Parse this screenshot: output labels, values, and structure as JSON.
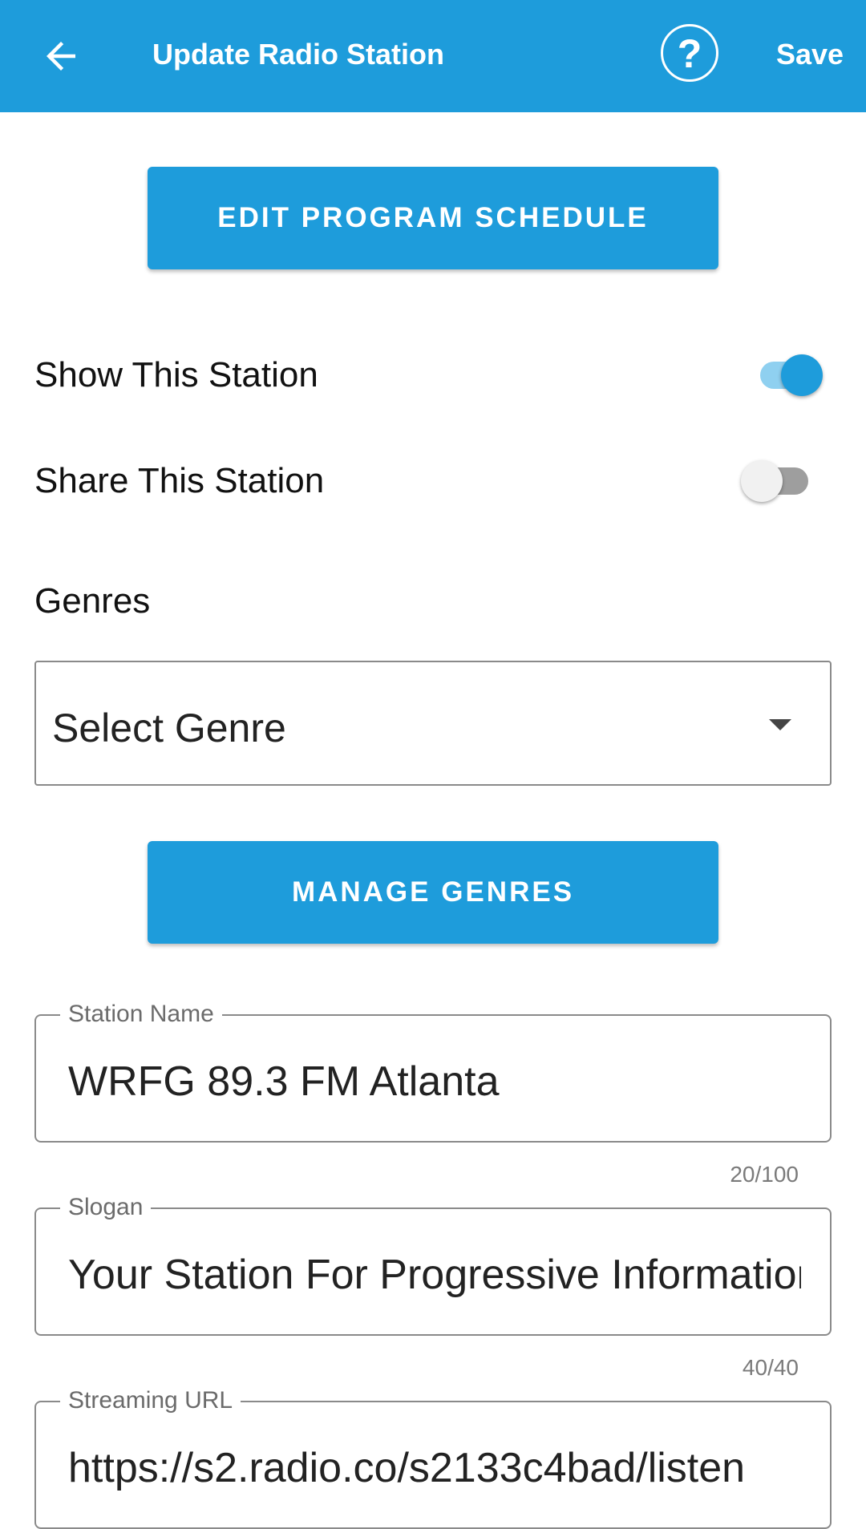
{
  "app_bar": {
    "title": "Update Radio Station",
    "help_symbol": "?",
    "save_label": "Save",
    "back_icon": "arrow-left-icon",
    "help_icon": "help-circle-icon"
  },
  "buttons": {
    "edit_schedule": "EDIT PROGRAM SCHEDULE",
    "manage_genres": "MANAGE GENRES"
  },
  "toggles": {
    "show_station": {
      "label": "Show This Station",
      "on": true
    },
    "share_station": {
      "label": "Share This Station",
      "on": false
    }
  },
  "genres": {
    "label": "Genres",
    "select_placeholder": "Select Genre",
    "arrow_icon": "dropdown-arrow-icon"
  },
  "fields": {
    "station_name": {
      "label": "Station Name",
      "value": "WRFG 89.3 FM Atlanta",
      "counter": "20/100"
    },
    "slogan": {
      "label": "Slogan",
      "value": "Your Station For Progressive Information",
      "counter": "40/40"
    },
    "streaming_url": {
      "label": "Streaming URL",
      "value": "https://s2.radio.co/s2133c4bad/listen"
    }
  },
  "colors": {
    "primary": "#1e9cdb",
    "switch_track_on": "#8fd0f0",
    "switch_track_off": "#9e9e9e",
    "switch_thumb_off": "#f1f1f1"
  }
}
